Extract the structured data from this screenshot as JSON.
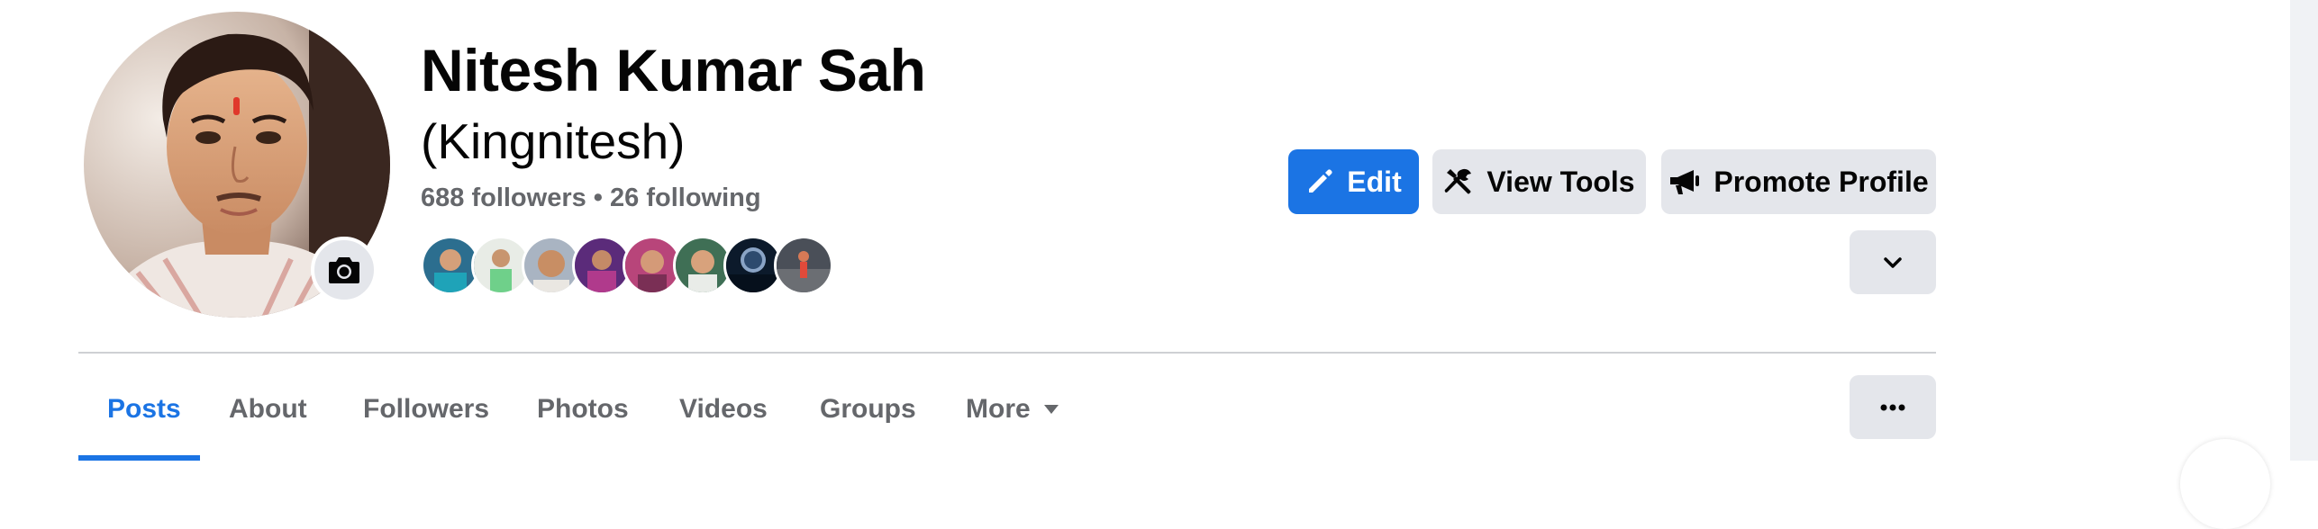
{
  "profile": {
    "name": "Nitesh Kumar Sah",
    "alternate_name": "(Kingnitesh)",
    "followers": "688 followers",
    "separator": " • ",
    "following": "26 following"
  },
  "friends_preview": [
    {
      "name": "friend-avatar-1"
    },
    {
      "name": "friend-avatar-2"
    },
    {
      "name": "friend-avatar-3"
    },
    {
      "name": "friend-avatar-4"
    },
    {
      "name": "friend-avatar-5"
    },
    {
      "name": "friend-avatar-6"
    },
    {
      "name": "friend-avatar-7"
    },
    {
      "name": "friend-avatar-8"
    }
  ],
  "actions": {
    "edit": {
      "label": "Edit",
      "icon": "pencil-icon"
    },
    "view_tools": {
      "label": "View Tools",
      "icon": "tools-icon"
    },
    "promote": {
      "label": "Promote Profile",
      "icon": "megaphone-icon"
    },
    "expand": {
      "icon": "chevron-down-icon"
    },
    "more_options": {
      "icon": "more-horizontal-icon"
    }
  },
  "tabs": [
    {
      "label": "Posts",
      "active": true
    },
    {
      "label": "About"
    },
    {
      "label": "Followers"
    },
    {
      "label": "Photos"
    },
    {
      "label": "Videos"
    },
    {
      "label": "Groups"
    },
    {
      "label": "More",
      "icon": "caret-down-icon"
    }
  ],
  "colors": {
    "accent": "#1b74e4",
    "secondary_button": "#e4e6eb",
    "muted_text": "#65676b",
    "divider": "#ced0d4"
  }
}
